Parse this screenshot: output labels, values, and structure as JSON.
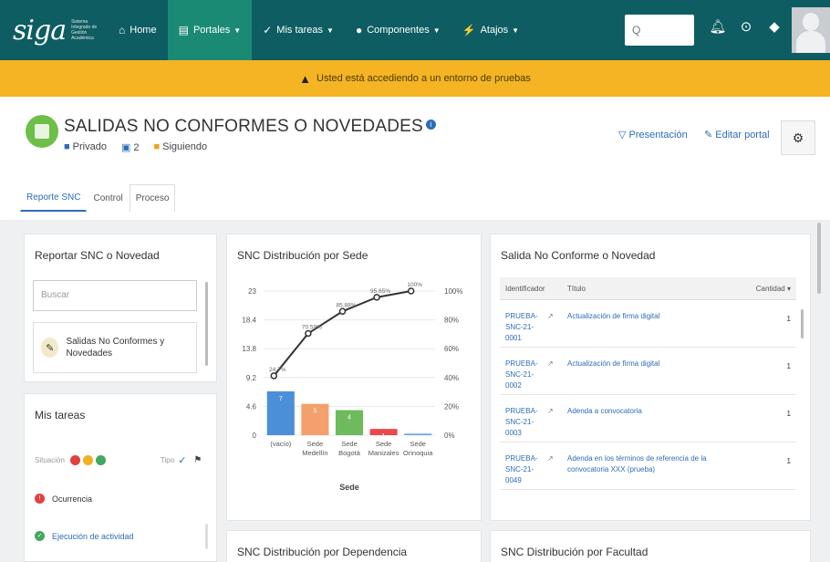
{
  "navbar": {
    "logo": "siga",
    "logo_small": "Sistema Integrado de Gestión Académica",
    "items": [
      {
        "label": "Home",
        "icon": "⌂"
      },
      {
        "label": "Portales",
        "icon": "▤"
      },
      {
        "label": "Mis tareas",
        "icon": "✓"
      },
      {
        "label": "Componentes",
        "icon": "●"
      },
      {
        "label": "Atajos",
        "icon": "⚡"
      }
    ],
    "search_placeholder": "Q"
  },
  "banner": {
    "text": "Usted está accediendo a un entorno de pruebas"
  },
  "header": {
    "title": "SALIDAS NO CONFORMES O NOVEDADES",
    "privacy": "Privado",
    "members": "2",
    "following": "Siguiendo",
    "presentation": "Presentación",
    "edit": "Editar portal"
  },
  "tabs": [
    "Reporte SNC",
    "Control",
    "Proceso"
  ],
  "report_card": {
    "title": "Reportar SNC o Novedad",
    "search_placeholder": "Buscar",
    "item_label": "Salidas No Conformes y Novedades"
  },
  "tasks_card": {
    "title": "Mis tareas",
    "situacion_label": "Situación",
    "tipo_label": "Tipo",
    "tasks": [
      "Ocurrencia",
      "Ejecución de actividad"
    ]
  },
  "chart_data": {
    "type": "bar",
    "title": "SNC Distribución por Sede",
    "xlabel": "Sede",
    "categories": [
      "(vacío)",
      "Sede Medellín",
      "Sede Bogotá",
      "Sede Manizales",
      "Sede Orinoquia"
    ],
    "values": [
      7,
      5,
      4,
      1,
      0
    ],
    "cumulative_pct": [
      41.18,
      70.59,
      85.88,
      95.65,
      100
    ],
    "bar_colors": [
      "#4c8fd9",
      "#f4a06c",
      "#6dbb5c",
      "#e84a4a",
      "#6aa9e8"
    ],
    "bar_value_labels": [
      "7",
      "5",
      "4",
      "1",
      "0"
    ],
    "point_labels": [
      "24.7%",
      "70.59%",
      "85.88%",
      "95.65%",
      "100%"
    ],
    "y_ticks": [
      "0",
      "4.6",
      "9.2",
      "13.8",
      "18.4",
      "23"
    ],
    "y_right_ticks": [
      "0%",
      "20%",
      "40%",
      "60%",
      "80%",
      "100%"
    ],
    "ylim": [
      0,
      23
    ],
    "y2lim": [
      0,
      100
    ],
    "grid": true,
    "line_color": "#333333"
  },
  "snc_table": {
    "title": "Salida No Conforme o Novedad",
    "headers": [
      "Identificador",
      "Título",
      "Cantidad"
    ],
    "rows": [
      {
        "id": "PRUEBA-SNC-21-0001",
        "titulo": "Actualización de firma digital",
        "cantidad": "1"
      },
      {
        "id": "PRUEBA-SNC-21-0002",
        "titulo": "Actualización de firma digital",
        "cantidad": "1"
      },
      {
        "id": "PRUEBA-SNC-21-0003",
        "titulo": "Adenda a convocatoria",
        "cantidad": "1"
      },
      {
        "id": "PRUEBA-SNC-21-0049",
        "titulo": "Adenda en los términos de referencia de la convocatoria XXX (prueba)",
        "cantidad": "1"
      }
    ]
  },
  "bottom_cards": {
    "dependencia": "SNC Distribución por Dependencia",
    "facultad": "SNC Distribución por Facultad"
  }
}
